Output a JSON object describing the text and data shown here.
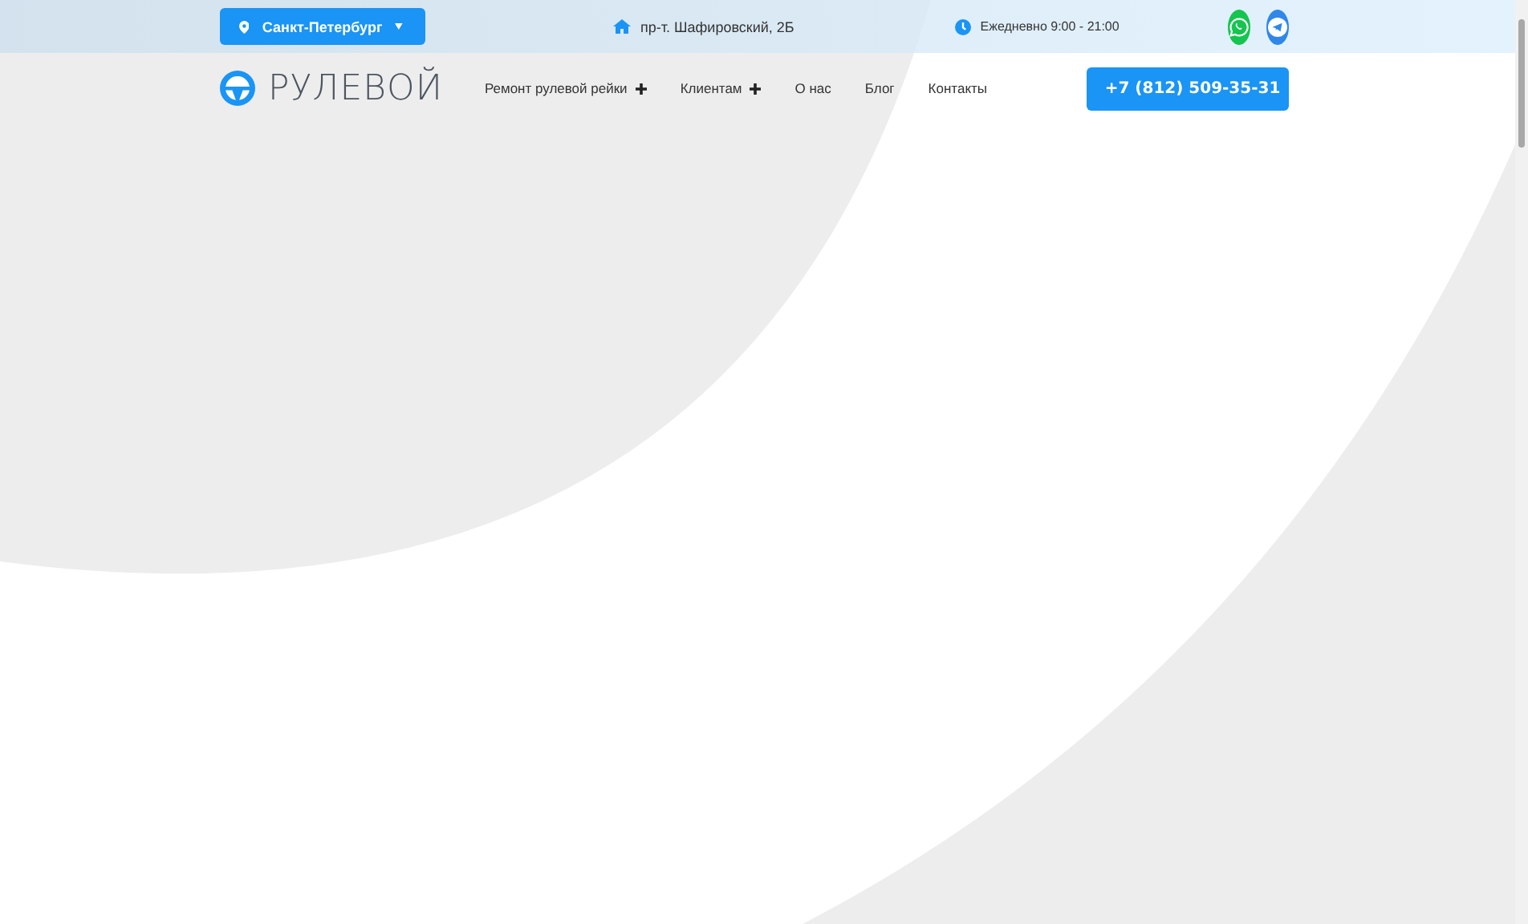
{
  "topbar": {
    "city": "Санкт-Петербург",
    "address": "пр-т. Шафировский, 2Б",
    "hours": "Ежедневно 9:00 - 21:00"
  },
  "header": {
    "logo": "РУЛЕВОЙ",
    "nav": [
      {
        "label": "Ремонт рулевой рейки",
        "has_submenu": true
      },
      {
        "label": "Клиентам",
        "has_submenu": true
      },
      {
        "label": "О нас",
        "has_submenu": false
      },
      {
        "label": "Блог",
        "has_submenu": false
      },
      {
        "label": "Контакты",
        "has_submenu": false
      }
    ],
    "phone": "+7 (812) 509-35-31"
  }
}
